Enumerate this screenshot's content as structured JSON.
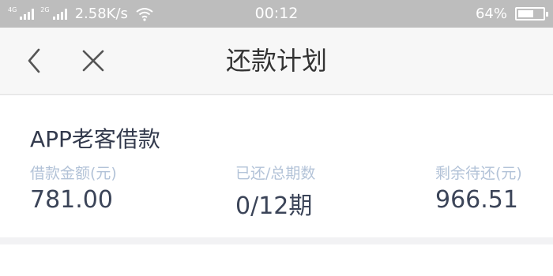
{
  "status_bar": {
    "net1": "4G",
    "net2": "2G",
    "speed": "2.58K/s",
    "time": "00:12",
    "battery_percent": "64%",
    "battery_level": 0.64,
    "icons": [
      "signal-icon",
      "wifi-icon",
      "battery-icon"
    ]
  },
  "nav": {
    "title": "还款计划",
    "icons": [
      "back-chevron-icon",
      "close-icon"
    ]
  },
  "loan": {
    "name": "APP老客借款",
    "stats": [
      {
        "label": "借款金额(元)",
        "value": "781.00"
      },
      {
        "label": "已还/总期数",
        "value": "0/12期"
      },
      {
        "label": "剩余待还(元)",
        "value": "966.51"
      }
    ]
  },
  "colors": {
    "status_bar_bg": "#bdbdbd",
    "nav_bg": "#f7f7f7",
    "page_bg": "#f2f2f4",
    "label_color": "#b3c3d8",
    "value_color": "#3b4458"
  }
}
